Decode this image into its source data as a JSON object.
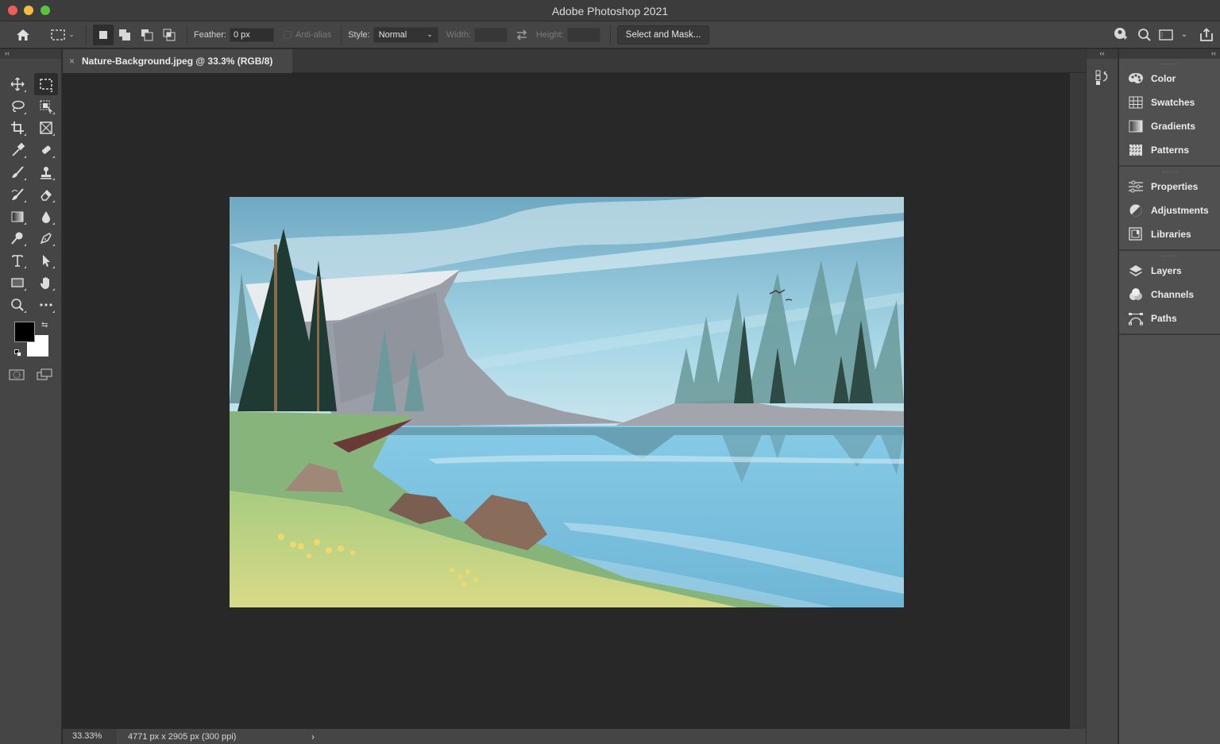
{
  "app": {
    "title": "Adobe Photoshop 2021"
  },
  "options_bar": {
    "home": "home-icon",
    "tool_preset": "rectangular-marquee-icon",
    "selection_modes": [
      "new-selection",
      "add-to-selection",
      "subtract-from-selection",
      "intersect-with-selection"
    ],
    "active_mode": "new-selection",
    "feather_label": "Feather:",
    "feather_value": "0 px",
    "antialias_label": "Anti-alias",
    "antialias_checked": false,
    "style_label": "Style:",
    "style_value": "Normal",
    "width_label": "Width:",
    "width_value": "",
    "height_label": "Height:",
    "height_value": "",
    "select_mask_label": "Select and Mask...",
    "right_icons": [
      "share-learn-icon",
      "search-icon",
      "workspace-icon",
      "chevron-down-icon",
      "share-icon"
    ]
  },
  "document": {
    "tab_title": "Nature-Background.jpeg @ 33.3% (RGB/8)",
    "close": "×"
  },
  "toolbar": {
    "collapse": "‹‹",
    "tools": [
      "move-tool",
      "rectangular-marquee-tool",
      "lasso-tool",
      "object-selection-tool",
      "crop-tool",
      "frame-tool",
      "eyedropper-tool",
      "spot-healing-brush-tool",
      "brush-tool",
      "clone-stamp-tool",
      "history-brush-tool",
      "eraser-tool",
      "gradient-tool",
      "blur-tool",
      "dodge-tool",
      "pen-tool",
      "type-tool",
      "path-selection-tool",
      "rectangle-tool",
      "hand-tool",
      "zoom-tool",
      "edit-toolbar"
    ],
    "active_tool": "rectangular-marquee-tool",
    "foreground_color": "#000000",
    "background_color": "#ffffff"
  },
  "status": {
    "zoom": "33.33%",
    "doc_info": "4771 px x 2905 px (300 ppi)",
    "arrow": "›"
  },
  "panels": {
    "collapse": "‹‹",
    "groups": [
      [
        {
          "label": "Color",
          "icon": "palette-icon"
        },
        {
          "label": "Swatches",
          "icon": "swatches-icon"
        },
        {
          "label": "Gradients",
          "icon": "gradients-icon"
        },
        {
          "label": "Patterns",
          "icon": "patterns-icon"
        }
      ],
      [
        {
          "label": "Properties",
          "icon": "sliders-icon"
        },
        {
          "label": "Adjustments",
          "icon": "adjustments-icon"
        },
        {
          "label": "Libraries",
          "icon": "libraries-icon"
        }
      ],
      [
        {
          "label": "Layers",
          "icon": "layers-icon"
        },
        {
          "label": "Channels",
          "icon": "channels-icon"
        },
        {
          "label": "Paths",
          "icon": "paths-icon"
        }
      ]
    ]
  },
  "colors": {
    "sky": "#8cc8dc",
    "lake": "#7cc4e0",
    "grass": "#9cc47c",
    "meadow": "#d4d884"
  }
}
